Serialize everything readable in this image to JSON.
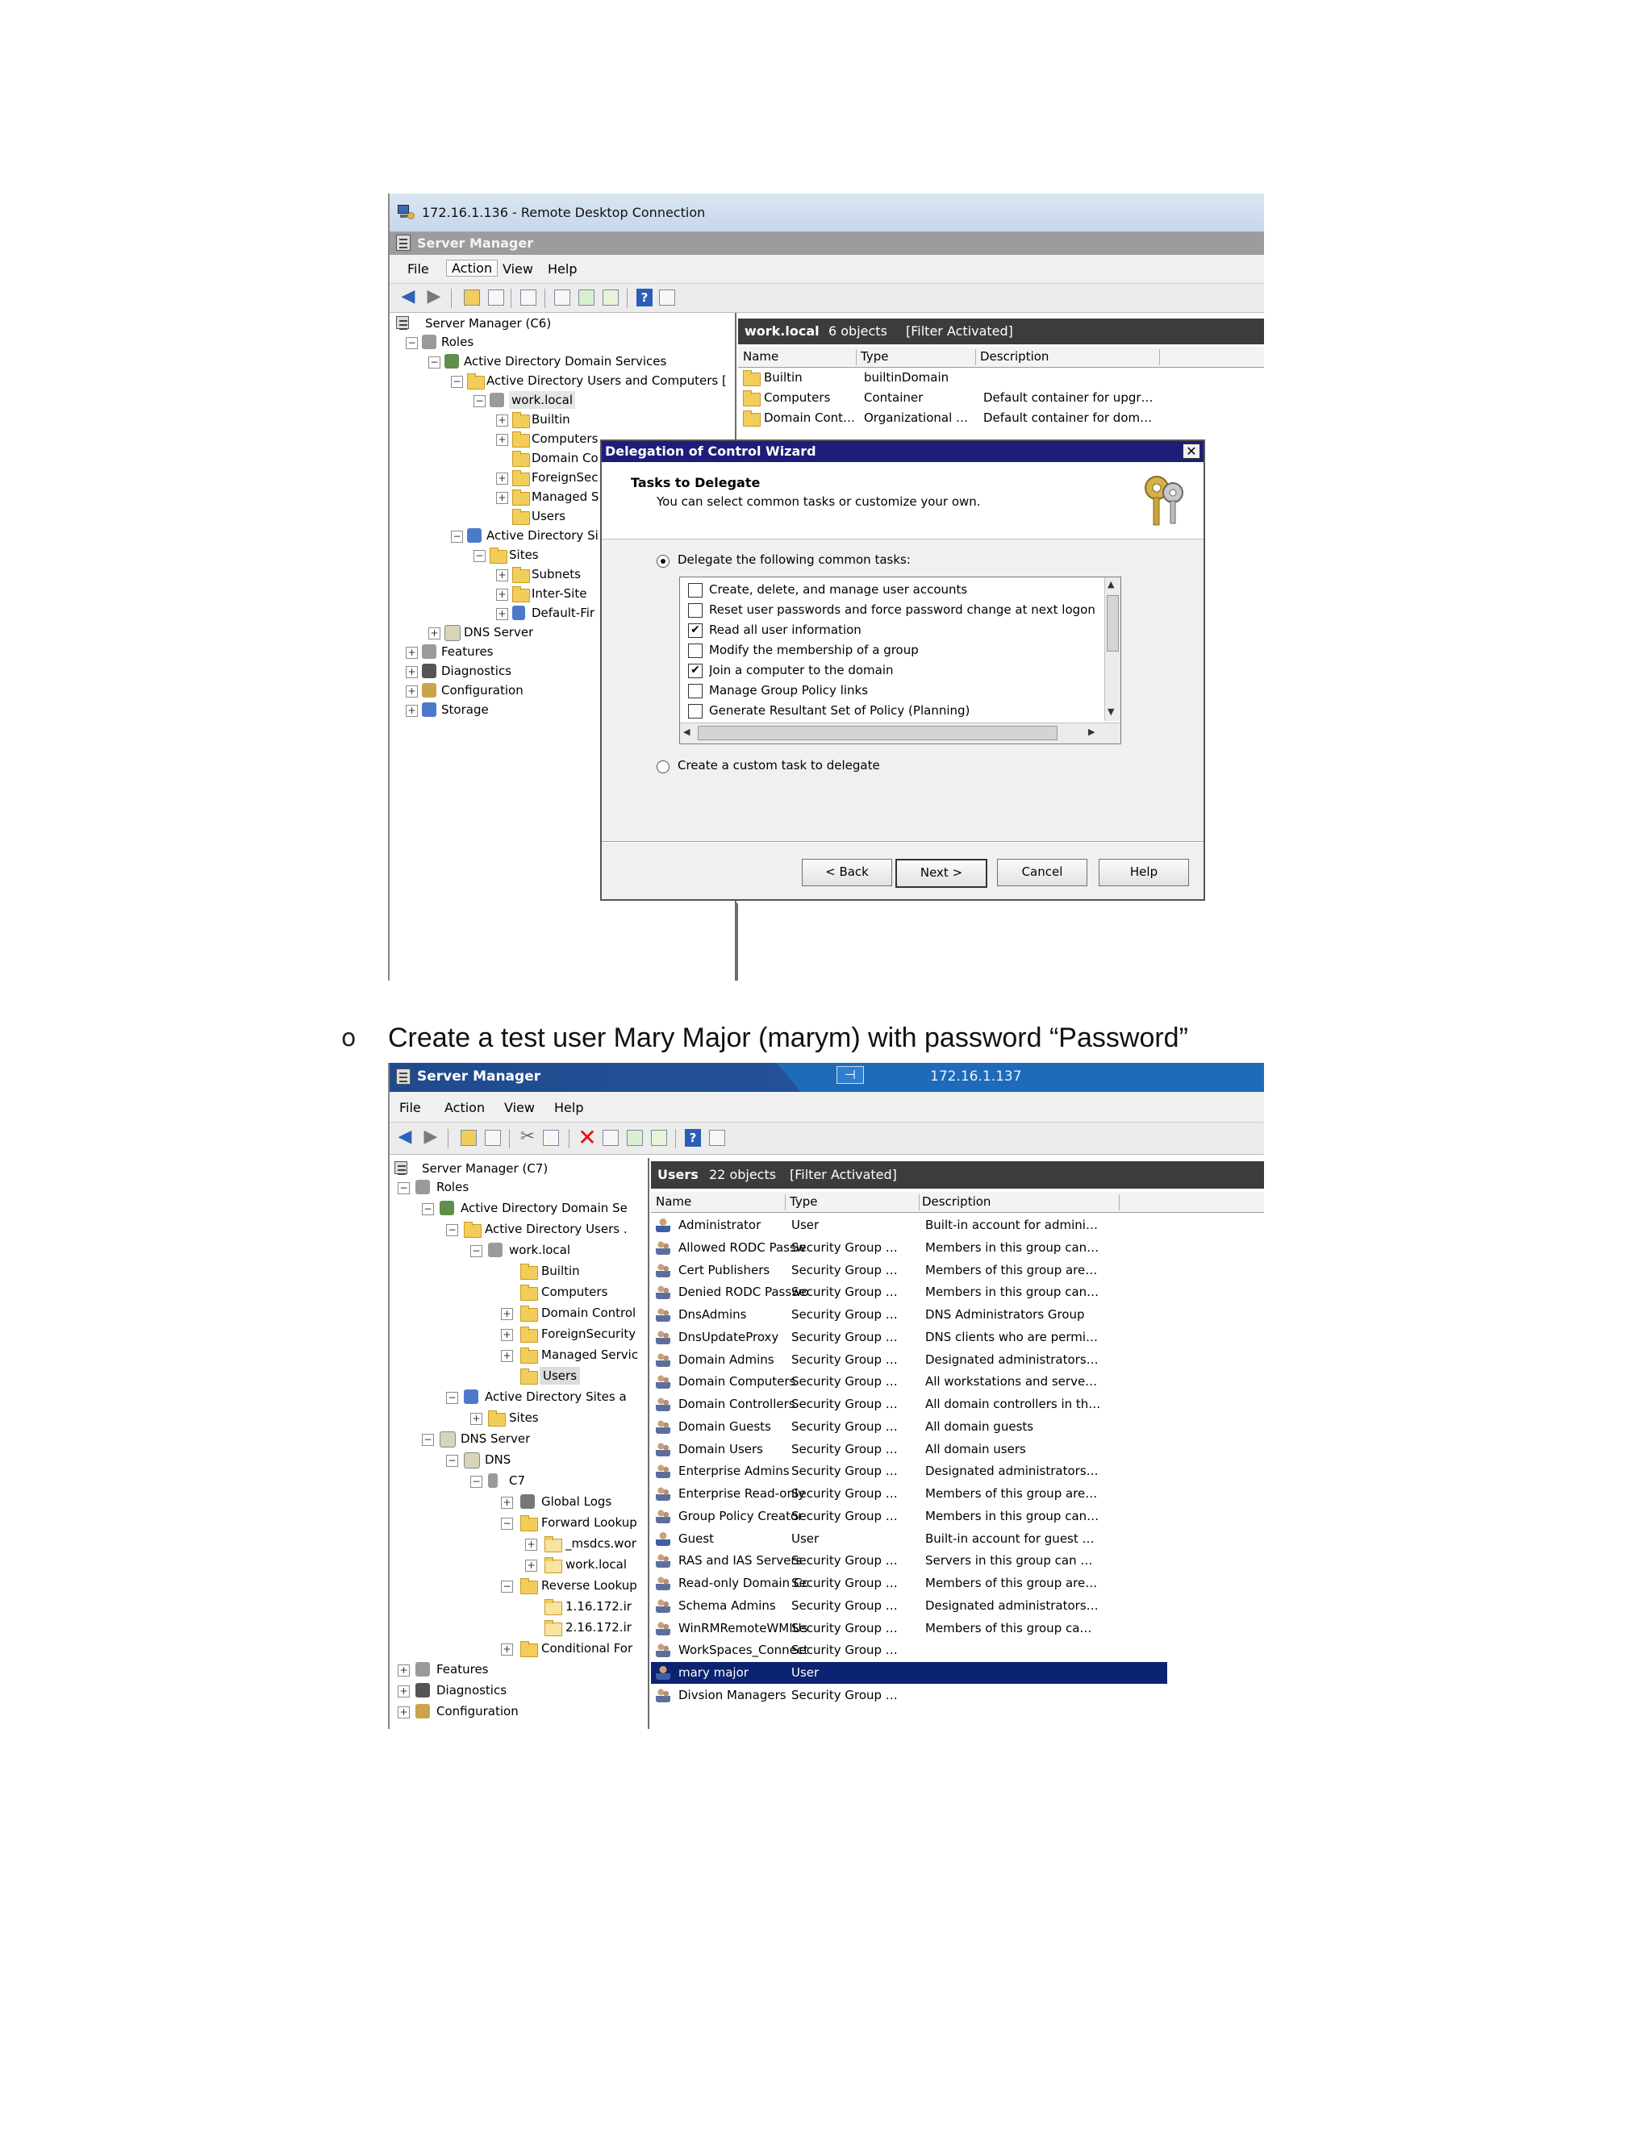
{
  "shot1": {
    "rdp_title": "172.16.1.136 - Remote Desktop Connection",
    "app_title": "Server Manager",
    "menu": [
      "File",
      "Action",
      "View",
      "Help"
    ],
    "tree": [
      {
        "label": "Server Manager (C6)"
      },
      {
        "label": "Roles"
      },
      {
        "label": "Active Directory Domain Services"
      },
      {
        "label": "Active Directory Users and Computers [ c"
      },
      {
        "label": "work.local"
      },
      {
        "label": "Builtin"
      },
      {
        "label": "Computers"
      },
      {
        "label": "Domain Co"
      },
      {
        "label": "ForeignSec"
      },
      {
        "label": "Managed S"
      },
      {
        "label": "Users"
      },
      {
        "label": "Active Directory Si"
      },
      {
        "label": "Sites"
      },
      {
        "label": "Subnets"
      },
      {
        "label": "Inter-Site"
      },
      {
        "label": "Default-Fir"
      },
      {
        "label": "DNS Server"
      },
      {
        "label": "Features"
      },
      {
        "label": "Diagnostics"
      },
      {
        "label": "Configuration"
      },
      {
        "label": "Storage"
      }
    ],
    "pane": {
      "title": "work.local",
      "count": "6 objects",
      "filter": "[Filter Activated]"
    },
    "columns": [
      "Name",
      "Type",
      "Description"
    ],
    "rows": [
      [
        "Builtin",
        "builtinDomain",
        ""
      ],
      [
        "Computers",
        "Container",
        "Default container for upgr…"
      ],
      [
        "Domain Cont…",
        "Organizational …",
        "Default container for dom…"
      ]
    ],
    "dialog": {
      "title": "Delegation of Control Wizard",
      "close": "✕",
      "heading": "Tasks to Delegate",
      "subheading": "You can select common tasks or customize your own.",
      "radio_common": "Delegate the following common tasks:",
      "tasks": [
        {
          "label": "Create, delete, and manage user accounts",
          "checked": false
        },
        {
          "label": "Reset user passwords and force password change at next logon",
          "checked": false
        },
        {
          "label": "Read all user information",
          "checked": true
        },
        {
          "label": "Modify the membership of a group",
          "checked": false
        },
        {
          "label": "Join a computer to the domain",
          "checked": true
        },
        {
          "label": "Manage Group Policy links",
          "checked": false
        },
        {
          "label": "Generate Resultant Set of Policy (Planning)",
          "checked": false
        }
      ],
      "radio_custom": "Create a custom task to delegate",
      "buttons": {
        "back": "< Back",
        "next": "Next >",
        "cancel": "Cancel",
        "help": "Help"
      }
    }
  },
  "caption": {
    "bullet": "o",
    "text": "Create a test user Mary Major (marym) with password “Password”"
  },
  "shot2": {
    "app_title": "Server Manager",
    "ip": "172.16.1.137",
    "pin": "⊣",
    "menu": [
      "File",
      "Action",
      "View",
      "Help"
    ],
    "tree": [
      {
        "label": "Server Manager (C7)"
      },
      {
        "label": "Roles"
      },
      {
        "label": "Active Directory Domain Se"
      },
      {
        "label": "Active Directory Users ."
      },
      {
        "label": "work.local"
      },
      {
        "label": "Builtin"
      },
      {
        "label": "Computers"
      },
      {
        "label": "Domain Control"
      },
      {
        "label": "ForeignSecurity"
      },
      {
        "label": "Managed Servic"
      },
      {
        "label": "Users"
      },
      {
        "label": "Active Directory Sites a"
      },
      {
        "label": "Sites"
      },
      {
        "label": "DNS Server"
      },
      {
        "label": "DNS"
      },
      {
        "label": "C7"
      },
      {
        "label": "Global Logs"
      },
      {
        "label": "Forward Lookup"
      },
      {
        "label": "_msdcs.wor"
      },
      {
        "label": "work.local"
      },
      {
        "label": "Reverse Lookup"
      },
      {
        "label": "1.16.172.ir"
      },
      {
        "label": "2.16.172.ir"
      },
      {
        "label": "Conditional For"
      },
      {
        "label": "Features"
      },
      {
        "label": "Diagnostics"
      },
      {
        "label": "Configuration"
      }
    ],
    "pane": {
      "title": "Users",
      "count": "22 objects",
      "filter": "[Filter Activated]"
    },
    "columns": [
      "Name",
      "Type",
      "Description"
    ],
    "rows": [
      {
        "name": "Administrator",
        "type": "User",
        "desc": "Built-in account for admini…",
        "icon": "user"
      },
      {
        "name": "Allowed RODC Passw…",
        "type": "Security Group …",
        "desc": "Members in this group can…",
        "icon": "group"
      },
      {
        "name": "Cert Publishers",
        "type": "Security Group …",
        "desc": "Members of this group are…",
        "icon": "group"
      },
      {
        "name": "Denied RODC Passwo…",
        "type": "Security Group …",
        "desc": "Members in this group can…",
        "icon": "group"
      },
      {
        "name": "DnsAdmins",
        "type": "Security Group …",
        "desc": "DNS Administrators Group",
        "icon": "group"
      },
      {
        "name": "DnsUpdateProxy",
        "type": "Security Group …",
        "desc": "DNS clients who are permi…",
        "icon": "group"
      },
      {
        "name": "Domain Admins",
        "type": "Security Group …",
        "desc": "Designated administrators…",
        "icon": "group"
      },
      {
        "name": "Domain Computers",
        "type": "Security Group …",
        "desc": "All workstations and serve…",
        "icon": "group"
      },
      {
        "name": "Domain Controllers",
        "type": "Security Group …",
        "desc": "All domain controllers in th…",
        "icon": "group"
      },
      {
        "name": "Domain Guests",
        "type": "Security Group …",
        "desc": "All domain guests",
        "icon": "group"
      },
      {
        "name": "Domain Users",
        "type": "Security Group …",
        "desc": "All domain users",
        "icon": "group"
      },
      {
        "name": "Enterprise Admins",
        "type": "Security Group …",
        "desc": "Designated administrators…",
        "icon": "group"
      },
      {
        "name": "Enterprise Read-only …",
        "type": "Security Group …",
        "desc": "Members of this group are…",
        "icon": "group"
      },
      {
        "name": "Group Policy Creator …",
        "type": "Security Group …",
        "desc": "Members in this group can…",
        "icon": "group"
      },
      {
        "name": "Guest",
        "type": "User",
        "desc": "Built-in account for guest …",
        "icon": "user"
      },
      {
        "name": "RAS and IAS Servers",
        "type": "Security Group …",
        "desc": "Servers in this group can …",
        "icon": "group"
      },
      {
        "name": "Read-only Domain Co…",
        "type": "Security Group …",
        "desc": "Members of this group are…",
        "icon": "group"
      },
      {
        "name": "Schema Admins",
        "type": "Security Group …",
        "desc": "Designated administrators…",
        "icon": "group"
      },
      {
        "name": "WinRMRemoteWMIUs…",
        "type": "Security Group …",
        "desc": "Members of this group ca…",
        "icon": "group"
      },
      {
        "name": "WorkSpaces_Connect…",
        "type": "Security Group …",
        "desc": "",
        "icon": "group"
      },
      {
        "name": "mary major",
        "type": "User",
        "desc": "",
        "icon": "user",
        "selected": true
      },
      {
        "name": "Divsion Managers",
        "type": "Security Group …",
        "desc": "",
        "icon": "group"
      }
    ]
  }
}
